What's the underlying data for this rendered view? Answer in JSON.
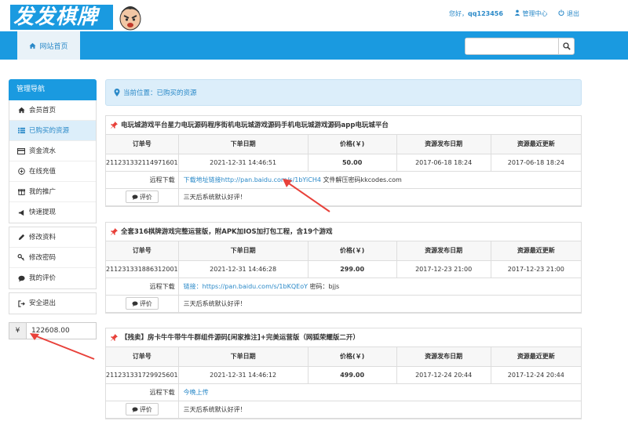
{
  "header": {
    "logo_text": "发发棋牌",
    "greeting": "您好，",
    "username": "qq123456",
    "manage_center": "管理中心",
    "logout": "退出"
  },
  "nav": {
    "home": "网站首页"
  },
  "search": {
    "placeholder": ""
  },
  "sidebar": {
    "title": "管理导航",
    "group1": [
      {
        "label": "会员首页",
        "icon": "home-icon"
      },
      {
        "label": "已购买的资源",
        "icon": "list-icon",
        "active": true
      },
      {
        "label": "资金流水",
        "icon": "card-icon"
      },
      {
        "label": "在线充值",
        "icon": "circle-plus-icon"
      },
      {
        "label": "我的推广",
        "icon": "gift-icon"
      },
      {
        "label": "快速提现",
        "icon": "bullhorn-icon"
      }
    ],
    "group2": [
      {
        "label": "修改资料",
        "icon": "pencil-icon"
      },
      {
        "label": "修改密码",
        "icon": "key-icon"
      },
      {
        "label": "我的评价",
        "icon": "comment-icon"
      }
    ],
    "group3": [
      {
        "label": "安全退出",
        "icon": "logout-icon"
      }
    ]
  },
  "balance": {
    "symbol": "¥",
    "value": "122608.00"
  },
  "location": {
    "text": "当前位置：已购买的资源"
  },
  "table_headers": [
    "订单号",
    "下单日期",
    "价格(￥)",
    "资源发布日期",
    "资源最近更新"
  ],
  "download_label": "远程下载",
  "review_label": "评价",
  "orders": [
    {
      "title": "电玩城游戏平台星力电玩源码程序街机电玩城游戏源码手机电玩城游戏源码app电玩城平台",
      "order_no": "211231332114971601",
      "order_date": "2021-12-31 14:46:51",
      "price": "50.00",
      "publish_date": "2017-06-18 18:24",
      "update_date": "2017-06-18 18:24",
      "download": "下载地址链接http://pan.baidu.com/s/1bYiCH4",
      "download_extra": " 文件解压密码kkcodes.com",
      "comment": "三天后系统默认好评！"
    },
    {
      "title": "全套316棋牌游戏完整运营版，附APK加IOS加打包工程，含19个游戏",
      "order_no": "211231331886312001",
      "order_date": "2021-12-31 14:46:28",
      "price": "299.00",
      "publish_date": "2017-12-23 21:00",
      "update_date": "2017-12-23 21:00",
      "download": "链接：https://pan.baidu.com/s/1bKQEoY",
      "download_extra": " 密码：bjjs",
      "comment": "三天后系统默认好评！"
    },
    {
      "title": "【残卖】房卡牛牛带牛牛群组件源码[闲家推注]+完美运营版（网狐荣耀版二开）",
      "order_no": "211231331729925601",
      "order_date": "2021-12-31 14:46:12",
      "price": "499.00",
      "publish_date": "2017-12-24 20:44",
      "update_date": "2017-12-24 20:44",
      "download": "今晚上传",
      "download_extra": "",
      "comment": "三天后系统默认好评！"
    }
  ],
  "colors": {
    "brand": "#1a9ae0",
    "link": "#2a89c8",
    "arrow": "#e8413a",
    "pin": "#e8413a"
  }
}
